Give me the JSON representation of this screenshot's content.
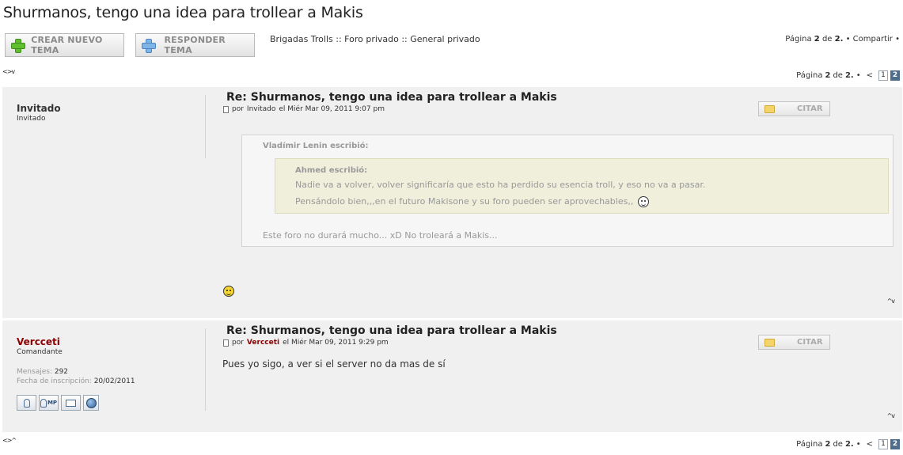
{
  "topic": {
    "title": "Shurmanos, tengo una idea para trollear a Makis"
  },
  "toolbar": {
    "new_topic_label": "CREAR NUEVO TEMA",
    "reply_label": "RESPONDER TEMA"
  },
  "breadcrumb": "Brigadas Trolls :: Foro privado :: General privado",
  "top_info": {
    "page_prefix": "Página",
    "page_current": "2",
    "page_of": "de",
    "page_total": "2.",
    "share": "• Compartir •"
  },
  "nav_arrows": {
    "top": "<>v",
    "bottom": "<>^"
  },
  "pagination": {
    "prefix": "Página",
    "current": "2",
    "of": "de",
    "total": "2.",
    "bullet": "•",
    "prev": "<",
    "pages": [
      "1",
      "2"
    ]
  },
  "posts": [
    {
      "author": "Invitado",
      "rank": "Invitado",
      "author_color": "#333333",
      "title": "Re: Shurmanos, tengo una idea para trollear a Makis",
      "meta_prefix": "por",
      "meta_author": "Invitado",
      "meta_date": "el Miér Mar 09, 2011 9:07 pm",
      "quote_label": "CITAR",
      "quote": {
        "header": "Vladímir Lenin escribió:",
        "inner_header": "Ahmed escribió:",
        "inner_lines": [
          "Nadie va a volver, volver significaría que esto ha perdido su esencia troll, y eso no va a pasar.",
          "Pensándolo bien,,,en el futuro Makisone y su foro pueden ser aprovechables,,"
        ],
        "tail": "Este foro no durará mucho... xD No troleará a Makis..."
      },
      "updown": "^v"
    },
    {
      "author": "Vercceti",
      "rank": "Comandante",
      "author_color": "#8b0000",
      "stats": [
        {
          "label": "Mensajes",
          "value": "292"
        },
        {
          "label": "Fecha de inscripción",
          "value": "20/02/2011"
        }
      ],
      "title": "Re: Shurmanos, tengo una idea para trollear a Makis",
      "meta_prefix": "por",
      "meta_author": "Vercceti",
      "meta_date": "el Miér Mar 09, 2011 9:29 pm",
      "quote_label": "CITAR",
      "body": "Pues yo sigo, a ver si el server no da mas de sí",
      "contact_icons": [
        "profile-icon",
        "private-message-icon",
        "email-icon",
        "website-icon"
      ],
      "contact_mp_text": "MP",
      "updown": "^v"
    }
  ]
}
